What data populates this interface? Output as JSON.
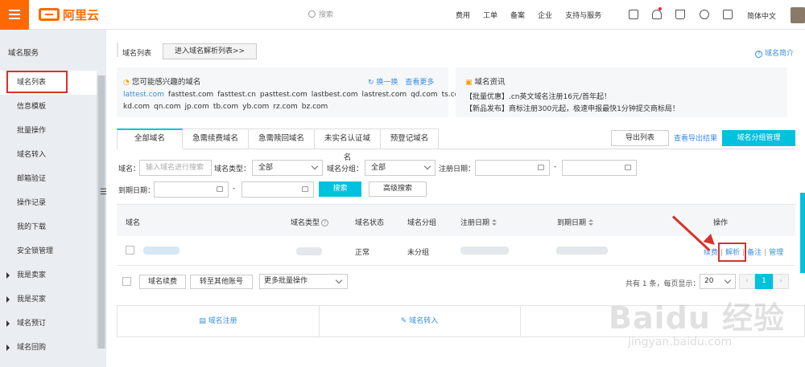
{
  "header": {
    "logo_text": "阿里云",
    "search_placeholder": "搜索",
    "nav": [
      "费用",
      "工单",
      "备案",
      "企业",
      "支持与服务"
    ],
    "language": "简体中文"
  },
  "sidebar": {
    "title": "域名服务",
    "items": [
      {
        "label": "域名列表",
        "active": true,
        "expandable": false
      },
      {
        "label": "信息模板",
        "active": false,
        "expandable": false
      },
      {
        "label": "批量操作",
        "active": false,
        "expandable": false
      },
      {
        "label": "域名转入",
        "active": false,
        "expandable": false
      },
      {
        "label": "邮箱验证",
        "active": false,
        "expandable": false
      },
      {
        "label": "操作记录",
        "active": false,
        "expandable": false
      },
      {
        "label": "我的下载",
        "active": false,
        "expandable": false
      },
      {
        "label": "安全锁管理",
        "active": false,
        "expandable": false
      },
      {
        "label": "我是卖家",
        "active": false,
        "expandable": true
      },
      {
        "label": "我是买家",
        "active": false,
        "expandable": true
      },
      {
        "label": "域名预订",
        "active": false,
        "expandable": true
      },
      {
        "label": "域名回购",
        "active": false,
        "expandable": true
      }
    ]
  },
  "page": {
    "title": "域名列表",
    "enter_dns_button": "进入域名解析列表>>",
    "help_link": "域名简介"
  },
  "suggest": {
    "title": "您可能感兴趣的域名",
    "refresh": "换一换",
    "more": "查看更多",
    "row1": [
      "lattest.com",
      "fasttest.com",
      "fasttest.cn",
      "pasttest.com",
      "lastbest.com",
      "lastrest.com",
      "qd.com",
      "ts.com"
    ],
    "row2": [
      "kd.com",
      "qn.com",
      "jp.com",
      "tb.com",
      "yb.com",
      "rz.com",
      "bz.com"
    ]
  },
  "news": {
    "title": "域名资讯",
    "items": [
      "【批量优惠】.cn英文域名注册16元/首年起！",
      "【新品发布】商标注册300元起，极速申报最快1分钟提交商标局！"
    ]
  },
  "tabs": [
    "全部域名",
    "急需续费域名",
    "急需赎回域名",
    "未实名认证域名",
    "预登记域名"
  ],
  "actions": {
    "export_button": "导出列表",
    "export_link": "查看导出结果",
    "group_button": "域名分组管理"
  },
  "filters": {
    "domain_label": "域名：",
    "domain_placeholder": "输入域名进行搜索",
    "type_label": "域名类型：",
    "type_value": "全部",
    "group_label": "域名分组：",
    "group_value": "全部",
    "reg_date_label": "注册日期：",
    "date_sep": "-",
    "exp_date_label": "到期日期：",
    "search_button": "搜索",
    "advanced_button": "高级搜索"
  },
  "table": {
    "headers": {
      "domain": "域名",
      "type": "域名类型",
      "status": "域名状态",
      "group": "域名分组",
      "reg_date": "注册日期",
      "exp_date": "到期日期",
      "ops": "操作"
    },
    "rows": [
      {
        "status": "正常",
        "group": "未分组",
        "ops": [
          "续费",
          "解析",
          "备注",
          "管理"
        ]
      }
    ]
  },
  "footer": {
    "renew_button": "域名续费",
    "transfer_button": "转至其他账号",
    "batch_select": "更多批量操作",
    "pager_text": "共有 1 条，每页显示：",
    "page_size": "20",
    "current_page": "1"
  },
  "quick": {
    "register": "域名注册",
    "transfer": "域名转入"
  },
  "watermark": {
    "main": "Baidu 经验",
    "sub": "jingyan.baidu.com"
  },
  "colors": {
    "brand": "#ff6a00",
    "accent": "#00c1de",
    "link": "#3a8ee6",
    "annotation": "#d9312b"
  }
}
